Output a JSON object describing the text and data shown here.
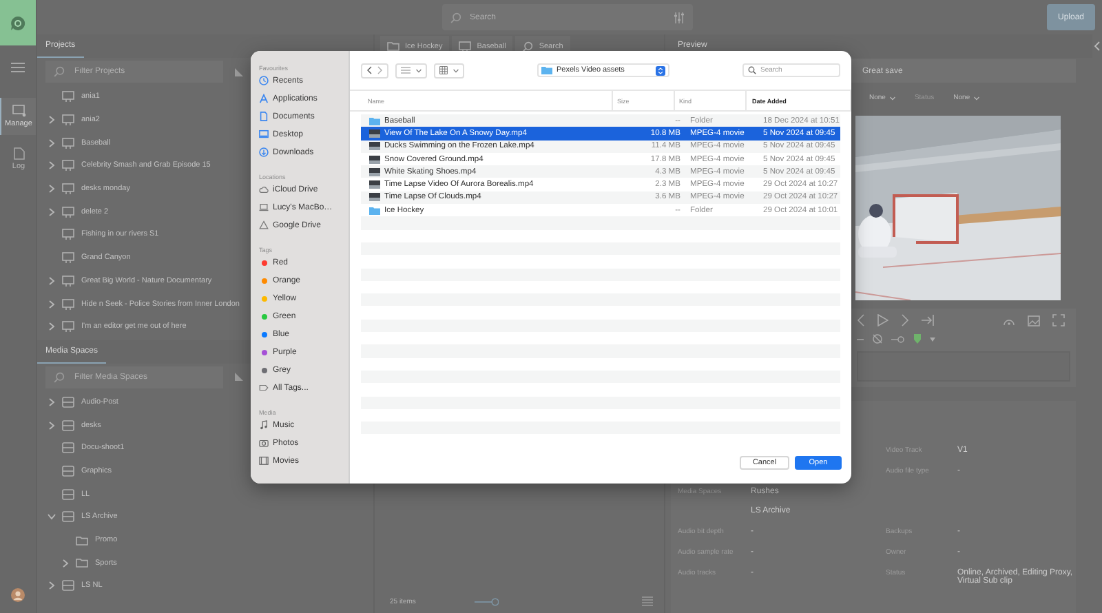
{
  "top_bar": {
    "search_placeholder": "Search",
    "upload_button": "Upload"
  },
  "rail": [
    {
      "label": "Manage",
      "kind": "manage",
      "selected": true
    },
    {
      "label": "Log",
      "kind": "log",
      "selected": false
    }
  ],
  "projects": {
    "title": "Projects",
    "filter_placeholder": "Filter Projects",
    "items": [
      {
        "label": "ania1",
        "expandable": false
      },
      {
        "label": "ania2",
        "expandable": true,
        "expanded": false
      },
      {
        "label": "Baseball",
        "expandable": true,
        "expanded": false
      },
      {
        "label": "Celebrity Smash and Grab Episode 15",
        "expandable": true,
        "expanded": false
      },
      {
        "label": "desks monday",
        "expandable": true,
        "expanded": false
      },
      {
        "label": "delete 2",
        "expandable": true,
        "expanded": false
      },
      {
        "label": "Fishing in our rivers S1",
        "expandable": false
      },
      {
        "label": "Grand Canyon",
        "expandable": false
      },
      {
        "label": "Great Big World - Nature Documentary",
        "expandable": true,
        "expanded": false
      },
      {
        "label": "Hide n Seek - Police Stories from Inner London",
        "expandable": true,
        "expanded": false
      },
      {
        "label": "I'm an editor get me out of here",
        "expandable": true,
        "expanded": false
      }
    ]
  },
  "media_spaces": {
    "title": "Media Spaces",
    "filter_placeholder": "Filter Media Spaces",
    "items": [
      {
        "label": "Audio-Post",
        "kind": "drive",
        "expandable": true,
        "expanded": false
      },
      {
        "label": "desks",
        "kind": "drive",
        "expandable": true,
        "expanded": false
      },
      {
        "label": "Docu-shoot1",
        "kind": "drive",
        "expandable": false
      },
      {
        "label": "Graphics",
        "kind": "drive",
        "expandable": false
      },
      {
        "label": "LL",
        "kind": "drive",
        "expandable": false
      },
      {
        "label": "LS Archive",
        "kind": "drive",
        "expandable": true,
        "expanded": true,
        "children": [
          {
            "label": "Promo",
            "kind": "folder",
            "expandable": false
          },
          {
            "label": "Sports",
            "kind": "folder",
            "expandable": true,
            "expanded": false
          }
        ]
      },
      {
        "label": "LS NL",
        "kind": "drive",
        "expandable": true,
        "expanded": false
      }
    ]
  },
  "browser": {
    "tabs": [
      {
        "label": "Ice Hockey",
        "kind": "folder"
      },
      {
        "label": "Baseball",
        "kind": "project"
      },
      {
        "label": "Search",
        "kind": "search"
      }
    ],
    "item_count": "25 items",
    "zoom_slider": {
      "level": 1
    }
  },
  "preview": {
    "title": "Preview",
    "clip_name": "Great save",
    "filters": [
      {
        "label": "None",
        "kind": "dropdown"
      },
      {
        "label": "Status",
        "kind": "label"
      },
      {
        "label": "None",
        "kind": "dropdown"
      }
    ],
    "metadata_rows": [
      {
        "right": {
          "label": "Video Track",
          "values": [
            "V1"
          ]
        }
      },
      {
        "right": {
          "label": "Audio file type",
          "values": [
            "-"
          ]
        }
      },
      {
        "left": {
          "label": "Media Spaces",
          "values": [
            "Rushes",
            "LS Archive"
          ]
        }
      },
      {
        "left": {
          "label": "Audio bit depth",
          "values": [
            "-"
          ]
        },
        "right": {
          "label": "Backups",
          "values": [
            "-"
          ]
        }
      },
      {
        "left": {
          "label": "Audio sample rate",
          "values": [
            "-"
          ]
        },
        "right": {
          "label": "Owner",
          "values": [
            "-"
          ]
        }
      },
      {
        "left": {
          "label": "Audio tracks",
          "values": [
            "-"
          ]
        },
        "right": {
          "label": "Status",
          "values": [
            "Online, Archived, Editing Proxy, Virtual Sub clip"
          ]
        }
      }
    ]
  },
  "dialog": {
    "location": "Pexels Video assets",
    "search_placeholder": "Search",
    "sidebar": [
      {
        "heading": "Favourites",
        "items": [
          {
            "label": "Recents",
            "kind": "clock"
          },
          {
            "label": "Applications",
            "kind": "apps"
          },
          {
            "label": "Documents",
            "kind": "document"
          },
          {
            "label": "Desktop",
            "kind": "desktop"
          },
          {
            "label": "Downloads",
            "kind": "download"
          }
        ]
      },
      {
        "heading": "Locations",
        "items": [
          {
            "label": "iCloud Drive",
            "kind": "cloud"
          },
          {
            "label": "Lucy's MacBo…",
            "kind": "laptop"
          },
          {
            "label": "Google Drive",
            "kind": "drive"
          }
        ]
      },
      {
        "heading": "Tags",
        "items": [
          {
            "label": "Red",
            "kind": "tag",
            "color": "#fe3b30"
          },
          {
            "label": "Orange",
            "kind": "tag",
            "color": "#fe8a00"
          },
          {
            "label": "Yellow",
            "kind": "tag",
            "color": "#fdb900"
          },
          {
            "label": "Green",
            "kind": "tag",
            "color": "#28c940"
          },
          {
            "label": "Blue",
            "kind": "tag",
            "color": "#0a7aff"
          },
          {
            "label": "Purple",
            "kind": "tag",
            "color": "#a550d6"
          },
          {
            "label": "Grey",
            "kind": "tag",
            "color": "#6e6e73"
          },
          {
            "label": "All Tags...",
            "kind": "alltags"
          }
        ]
      },
      {
        "heading": "Media",
        "items": [
          {
            "label": "Music",
            "kind": "music"
          },
          {
            "label": "Photos",
            "kind": "camera"
          },
          {
            "label": "Movies",
            "kind": "film"
          }
        ]
      }
    ],
    "columns": [
      {
        "label": "Name",
        "sorted": false
      },
      {
        "label": "Size",
        "sorted": false
      },
      {
        "label": "Kind",
        "sorted": false
      },
      {
        "label": "Date Added",
        "sorted": true
      }
    ],
    "files": [
      {
        "name": "Baseball",
        "size": "--",
        "kind_label": "Folder",
        "date": "18 Dec 2024 at 10:51",
        "kind": "folder",
        "selected": false
      },
      {
        "name": "View Of The Lake On A Snowy Day.mp4",
        "size": "10.8 MB",
        "kind_label": "MPEG-4 movie",
        "date": "5 Nov 2024 at 09:45",
        "kind": "video",
        "selected": true
      },
      {
        "name": "Ducks Swimming on the Frozen Lake.mp4",
        "size": "11.4 MB",
        "kind_label": "MPEG-4 movie",
        "date": "5 Nov 2024 at 09:45",
        "kind": "video",
        "selected": false
      },
      {
        "name": "Snow Covered Ground.mp4",
        "size": "17.8 MB",
        "kind_label": "MPEG-4 movie",
        "date": "5 Nov 2024 at 09:45",
        "kind": "video",
        "selected": false
      },
      {
        "name": "White Skating Shoes.mp4",
        "size": "4.3 MB",
        "kind_label": "MPEG-4 movie",
        "date": "5 Nov 2024 at 09:45",
        "kind": "video",
        "selected": false
      },
      {
        "name": "Time Lapse Video Of Aurora Borealis.mp4",
        "size": "2.3 MB",
        "kind_label": "MPEG-4 movie",
        "date": "29 Oct 2024 at 10:27",
        "kind": "video",
        "selected": false
      },
      {
        "name": "Time Lapse Of Clouds.mp4",
        "size": "3.6 MB",
        "kind_label": "MPEG-4 movie",
        "date": "29 Oct 2024 at 10:27",
        "kind": "video",
        "selected": false
      },
      {
        "name": "Ice Hockey",
        "size": "--",
        "kind_label": "Folder",
        "date": "29 Oct 2024 at 10:01",
        "kind": "folder",
        "selected": false
      }
    ],
    "cancel_button": "Cancel",
    "open_button": "Open"
  }
}
